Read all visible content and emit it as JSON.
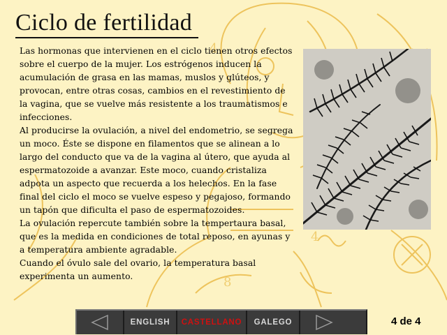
{
  "page": {
    "title": "Ciclo de fertilidad",
    "paragraphs": [
      "Las hormonas que intervienen en el ciclo tienen otros efectos sobre el cuerpo de la mujer. Los estrógenos inducen la acumulación de grasa en las mamas, muslos y glúteos, y provocan, entre otras cosas, cambios en el revestimiento de la vagina, que se vuelve más resistente a los traumatismos e infecciones.",
      "Al producirse la ovulación, a nivel del endometrio, se segrega un moco. Éste se dispone en filamentos que se alinean a lo largo del conducto que va de la vagina al útero, que ayuda al espermatozoide a avanzar. Este moco, cuando cristaliza adpota un aspecto que recuerda a los helechos. En la fase final del ciclo el moco se vuelve espeso y pegajoso, formando un tapón que dificulta el paso de espermatozoides.",
      "La ovulación repercute también sobre la tempertaura basal, que es la medida en condiciones de total reposo, en ayunas y a temperatura ambiente agradable.",
      "Cuando el óvulo sale del ovario, la temperatura basal experimenta un aumento."
    ],
    "page_indicator": "4 de 4"
  },
  "navbar": {
    "prev_icon": "left-triangle-icon",
    "next_icon": "right-triangle-icon",
    "languages": [
      "ENGLISH",
      "CASTELLANO",
      "GALEGO"
    ],
    "active_language": "CASTELLANO"
  },
  "colors": {
    "background": "#fdf3c4",
    "sketch_lines": "#e8b43a",
    "navbar": "#3b3b3b",
    "active_language": "#d01010",
    "inactive_language": "#d8d8d8"
  }
}
